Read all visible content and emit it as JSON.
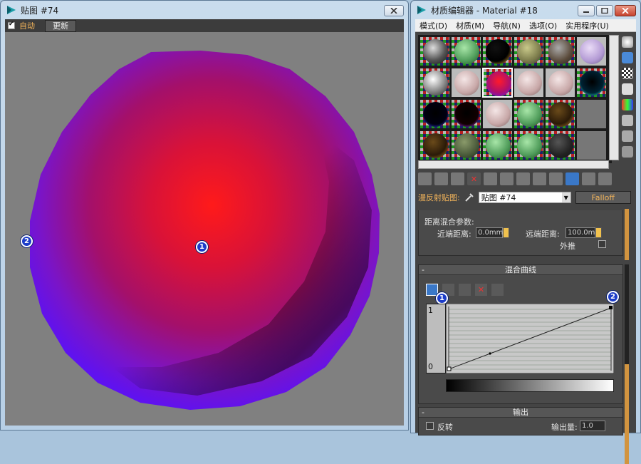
{
  "map_window": {
    "title": "贴图 #74",
    "auto_label": "自动",
    "update_label": "更新",
    "auto_checked": true
  },
  "material_editor": {
    "title": "材质编辑器 - Material #18",
    "menu": [
      "模式(D)",
      "材质(M)",
      "导航(N)",
      "选项(O)",
      "实用程序(U)"
    ],
    "diffuse_label": "漫反射贴图:",
    "map_dropdown_value": "贴图 #74",
    "falloff_button": "Falloff",
    "distance_blend": {
      "heading": "距离混合参数:",
      "near_label": "近端距离:",
      "near_value": "0.0mm",
      "far_label": "远端距离:",
      "far_value": "100.0mm",
      "extrapolate_label": "外推"
    },
    "mix_curve": {
      "title": "混合曲线",
      "axis_top": "1",
      "axis_bottom": "0"
    },
    "output": {
      "title": "输出",
      "invert_label": "反转",
      "output_amount_label": "输出量:",
      "output_amount_value": "1.0"
    }
  },
  "markers": {
    "m1": "1",
    "m2": "2",
    "r1": "1",
    "r2": "2"
  },
  "colors": {
    "sphere_center": "#e8192a",
    "sphere_edge": "#6a18e8",
    "canvas_bg": "#808080",
    "accent_orange": "#f3b45a",
    "marker_blue": "#1c3cc9"
  }
}
